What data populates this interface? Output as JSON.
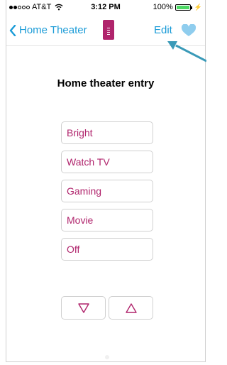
{
  "status_bar": {
    "carrier": "AT&T",
    "time": "3:12 PM",
    "battery": "100%",
    "signal_dots_filled": 2,
    "signal_dots_total": 5
  },
  "nav": {
    "back_label": "Home Theater",
    "edit_label": "Edit",
    "accent_color": "#1a9bd7",
    "brand_color": "#b0246c"
  },
  "page": {
    "title": "Home theater entry"
  },
  "activities": [
    {
      "label": "Bright"
    },
    {
      "label": "Watch TV"
    },
    {
      "label": "Gaming"
    },
    {
      "label": "Movie"
    },
    {
      "label": "Off"
    }
  ],
  "controls": {
    "down_icon": "triangle-down-icon",
    "up_icon": "triangle-up-icon"
  }
}
